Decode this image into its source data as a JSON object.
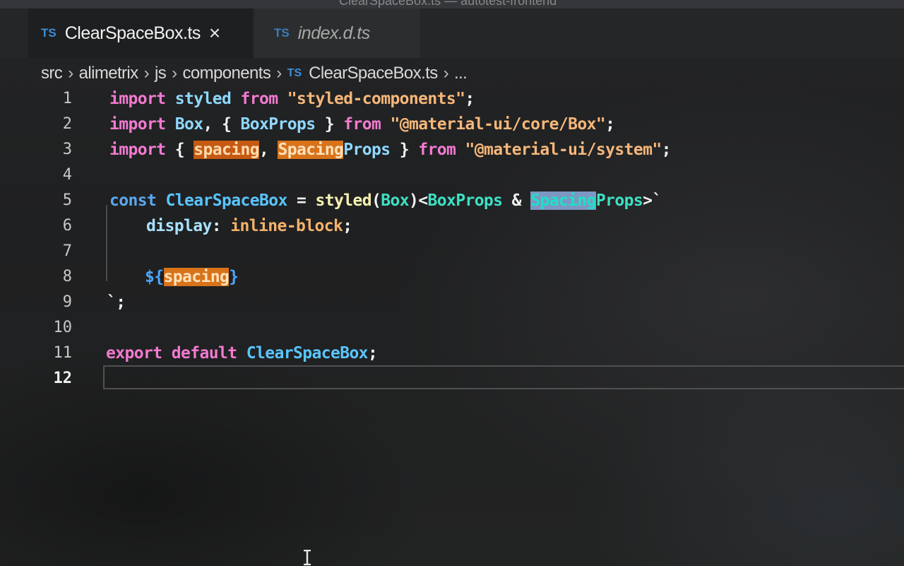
{
  "window": {
    "title": "ClearSpaceBox.ts — autotest-frontend"
  },
  "tabs": [
    {
      "icon": "TS",
      "label": "ClearSpaceBox.ts",
      "active": true,
      "close": "×"
    },
    {
      "icon": "TS",
      "label": "index.d.ts",
      "active": false
    }
  ],
  "breadcrumb": {
    "items": [
      "src",
      "alimetrix",
      "js",
      "components"
    ],
    "file_icon": "TS",
    "file": "ClearSpaceBox.ts",
    "ellipsis": "...",
    "separator": "›"
  },
  "editor": {
    "language": "typescript",
    "current_line": 12,
    "lines": [
      {
        "n": "1",
        "tokens": [
          [
            "kw",
            "import"
          ],
          [
            "punct",
            " "
          ],
          [
            "ident",
            "styled"
          ],
          [
            "punct",
            " "
          ],
          [
            "kw",
            "from"
          ],
          [
            "punct",
            " "
          ],
          [
            "str",
            "\"styled-components\""
          ],
          [
            "punct",
            ";"
          ]
        ]
      },
      {
        "n": "2",
        "tokens": [
          [
            "kw",
            "import"
          ],
          [
            "punct",
            " "
          ],
          [
            "ident",
            "Box"
          ],
          [
            "punct",
            ", { "
          ],
          [
            "ident",
            "BoxProps"
          ],
          [
            "punct",
            " } "
          ],
          [
            "kw",
            "from"
          ],
          [
            "punct",
            " "
          ],
          [
            "str",
            "\"@material-ui/core/Box\""
          ],
          [
            "punct",
            ";"
          ]
        ]
      },
      {
        "n": "3",
        "tokens": [
          [
            "kw",
            "import"
          ],
          [
            "punct",
            " { "
          ],
          [
            "hl-orange",
            "spacing"
          ],
          [
            "punct",
            ", "
          ],
          [
            "hl-orange2",
            "Spacing"
          ],
          [
            "ident",
            "Props"
          ],
          [
            "punct",
            " } "
          ],
          [
            "kw",
            "from"
          ],
          [
            "punct",
            " "
          ],
          [
            "str",
            "\"@material-ui/system\""
          ],
          [
            "punct",
            ";"
          ]
        ]
      },
      {
        "n": "4",
        "tokens": []
      },
      {
        "n": "5",
        "tokens": [
          [
            "kw2",
            "const"
          ],
          [
            "punct",
            " "
          ],
          [
            "cls",
            "ClearSpaceBox"
          ],
          [
            "punct",
            " = "
          ],
          [
            "fn",
            "styled"
          ],
          [
            "punct",
            "("
          ],
          [
            "type",
            "Box"
          ],
          [
            "punct",
            ")<"
          ],
          [
            "type",
            "BoxProps"
          ],
          [
            "punct",
            " & "
          ],
          [
            "hl-select",
            "Spacing"
          ],
          [
            "type",
            "Props"
          ],
          [
            "punct",
            ">`"
          ]
        ]
      },
      {
        "n": "6",
        "tokens": [
          [
            "punct",
            "    "
          ],
          [
            "prop",
            "display"
          ],
          [
            "punct",
            ": "
          ],
          [
            "val",
            "inline-block"
          ],
          [
            "punct",
            ";"
          ]
        ]
      },
      {
        "n": "7",
        "tokens": []
      },
      {
        "n": "8",
        "tokens": [
          [
            "punct",
            "    "
          ],
          [
            "interp",
            "${"
          ],
          [
            "hl-orange2",
            "spacing"
          ],
          [
            "interp",
            "}"
          ]
        ]
      },
      {
        "n": "9",
        "tokens": [
          [
            "punct",
            "`;"
          ]
        ]
      },
      {
        "n": "10",
        "tokens": []
      },
      {
        "n": "11",
        "tokens": [
          [
            "kw",
            "export"
          ],
          [
            "punct",
            " "
          ],
          [
            "kw",
            "default"
          ],
          [
            "punct",
            " "
          ],
          [
            "cls",
            "ClearSpaceBox"
          ],
          [
            "punct",
            ";"
          ]
        ]
      },
      {
        "n": "12",
        "tokens": []
      }
    ]
  },
  "colors": {
    "keyword": "#f27ad0",
    "string": "#f6b77a",
    "type": "#3ee0c4",
    "class": "#59c5ff",
    "ts_icon": "#3c8fd6",
    "highlight_orange": "#c65a12",
    "selection": "#7d97c4"
  }
}
